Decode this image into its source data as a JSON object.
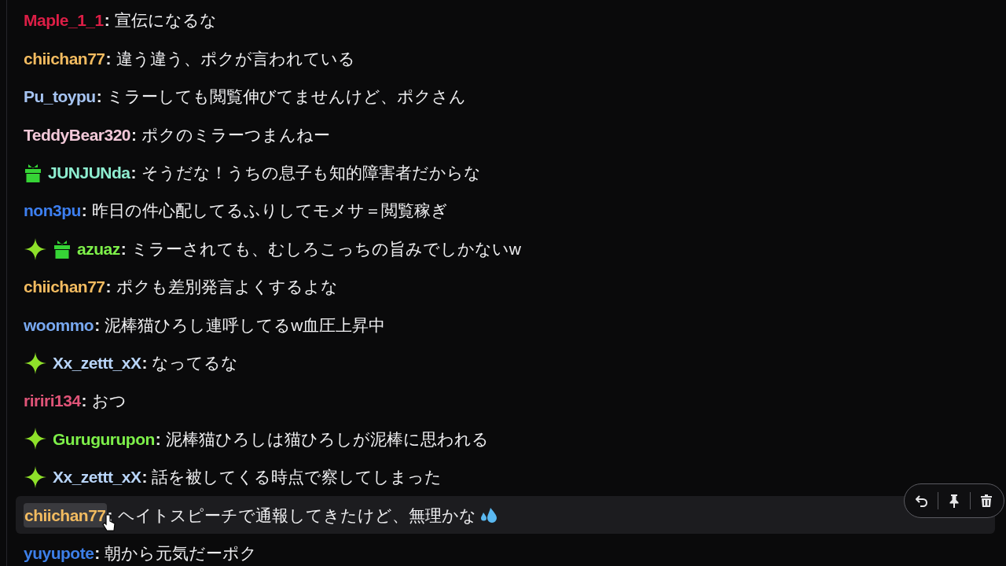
{
  "messages": [
    {
      "user": "Maple_1_1",
      "color": "#dc1e46",
      "sep": ":",
      "text": "宣伝になるな",
      "sparkle_badge": false,
      "gift_badge": false,
      "hovered": false,
      "sweat_emote": false
    },
    {
      "user": "chiichan77",
      "color": "#f2bb60",
      "sep": ":",
      "text": "違う違う、ポクが言われている",
      "sparkle_badge": false,
      "gift_badge": false,
      "hovered": false,
      "sweat_emote": false
    },
    {
      "user": "Pu_toypu",
      "color": "#a6c4f2",
      "sep": ":",
      "text": "ミラーしても閲覧伸びてませんけど、ポクさん",
      "sparkle_badge": false,
      "gift_badge": false,
      "hovered": false,
      "sweat_emote": false
    },
    {
      "user": "TeddyBear320",
      "color": "#f2c8d8",
      "sep": ":",
      "text": "ポクのミラーつまんねー",
      "sparkle_badge": false,
      "gift_badge": false,
      "hovered": false,
      "sweat_emote": false
    },
    {
      "user": "JUNJUNda",
      "color": "#8eeed0",
      "sep": ":",
      "text": "そうだな！うちの息子も知的障害者だからな",
      "sparkle_badge": false,
      "gift_badge": true,
      "hovered": false,
      "sweat_emote": false
    },
    {
      "user": "non3pu",
      "color": "#3d7ff0",
      "sep": ":",
      "text": "昨日の件心配してるふりしてモメサ＝閲覧稼ぎ",
      "sparkle_badge": false,
      "gift_badge": false,
      "hovered": false,
      "sweat_emote": false
    },
    {
      "user": "azuaz",
      "color": "#7ef04a",
      "sep": ":",
      "text": "ミラーされても、むしろこっちの旨みでしかないw",
      "sparkle_badge": true,
      "gift_badge": true,
      "hovered": false,
      "sweat_emote": false
    },
    {
      "user": "chiichan77",
      "color": "#f2bb60",
      "sep": ":",
      "text": "ポクも差別発言よくするよな",
      "sparkle_badge": false,
      "gift_badge": false,
      "hovered": false,
      "sweat_emote": false
    },
    {
      "user": "woommo",
      "color": "#78a8f0",
      "sep": ":",
      "text": "泥棒猫ひろし連呼してるw血圧上昇中",
      "sparkle_badge": false,
      "gift_badge": false,
      "hovered": false,
      "sweat_emote": false
    },
    {
      "user": "Xx_zettt_xX",
      "color": "#b8d4f8",
      "sep": ":",
      "text": "なってるな",
      "sparkle_badge": true,
      "gift_badge": false,
      "hovered": false,
      "sweat_emote": false
    },
    {
      "user": "ririri134",
      "color": "#e05478",
      "sep": ":",
      "text": "おつ",
      "sparkle_badge": false,
      "gift_badge": false,
      "hovered": false,
      "sweat_emote": false
    },
    {
      "user": "Gurugurupon",
      "color": "#7ef04a",
      "sep": ":",
      "text": "泥棒猫ひろしは猫ひろしが泥棒に思われる",
      "sparkle_badge": true,
      "gift_badge": false,
      "hovered": false,
      "sweat_emote": false
    },
    {
      "user": "Xx_zettt_xX",
      "color": "#b8d4f8",
      "sep": ":",
      "text": "話を被してくる時点で察してしまった",
      "sparkle_badge": true,
      "gift_badge": false,
      "hovered": false,
      "sweat_emote": false
    },
    {
      "user": "chiichan77",
      "color": "#f2bb60",
      "sep": ":",
      "text": "ヘイトスピーチで通報してきたけど、無理かな",
      "sparkle_badge": false,
      "gift_badge": false,
      "hovered": true,
      "sweat_emote": true
    },
    {
      "user": "yuyupote",
      "color": "#3d7fe8",
      "sep": ":",
      "text": "朝から元気だーポク",
      "sparkle_badge": false,
      "gift_badge": false,
      "hovered": false,
      "sweat_emote": false
    }
  ]
}
